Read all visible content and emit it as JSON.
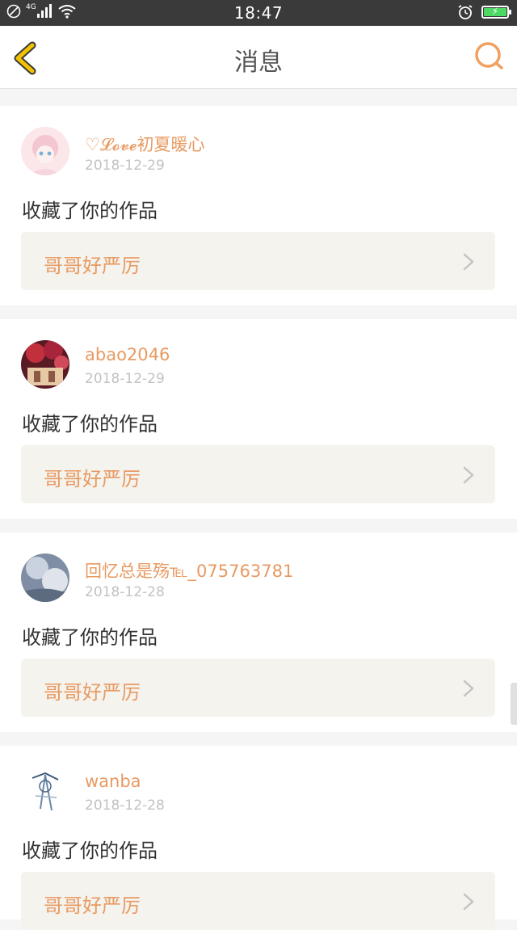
{
  "status_bar": {
    "network": "4G",
    "time": "18:47"
  },
  "header": {
    "title": "消息",
    "back_icon": "chevron-left-icon",
    "search_icon": "search-icon",
    "accent_color": "#f0a060",
    "back_color": "#f2c200"
  },
  "messages": [
    {
      "username": "♡𝓛𝓸𝓿𝓮初夏暖心",
      "date": "2018-12-29",
      "action": "收藏了你的作品",
      "work_title": "哥哥好严厉",
      "avatar_color": "#f6d6de"
    },
    {
      "username": "abao2046",
      "date": "2018-12-29",
      "action": "收藏了你的作品",
      "work_title": "哥哥好严厉",
      "avatar_color": "#8a2a3a"
    },
    {
      "username": "回忆总是殇℡_075763781",
      "date": "2018-12-28",
      "action": "收藏了你的作品",
      "work_title": "哥哥好严厉",
      "avatar_color": "#a8b4c4"
    },
    {
      "username": "wanba",
      "date": "2018-12-28",
      "action": "收藏了你的作品",
      "work_title": "哥哥好严厉",
      "avatar_color": "#e6ecf2"
    }
  ]
}
